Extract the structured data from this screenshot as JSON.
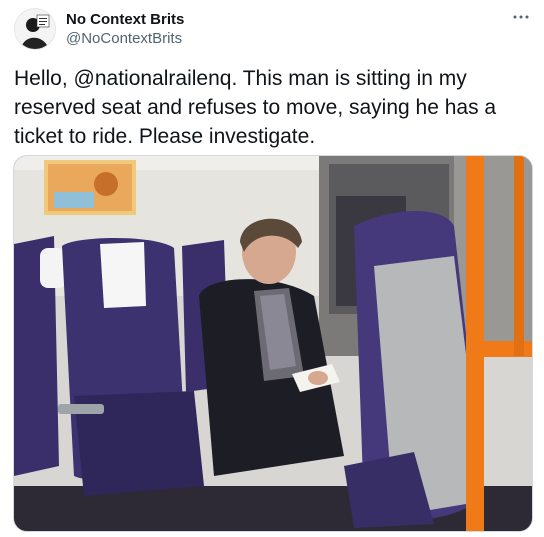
{
  "tweet": {
    "display_name": "No Context Brits",
    "handle": "@NoContextBrits",
    "text": "Hello, @nationalrailenq. This man is sitting in my reserved seat and refuses to move, saying he has a ticket to ride. Please investigate.",
    "avatar_icon": "profile-avatar-icon",
    "more_icon": "more-options-icon"
  },
  "colors": {
    "text_primary": "#0f1419",
    "text_secondary": "#536471",
    "seat_purple": "#3b2f6b",
    "handrail_orange": "#f07a17"
  }
}
